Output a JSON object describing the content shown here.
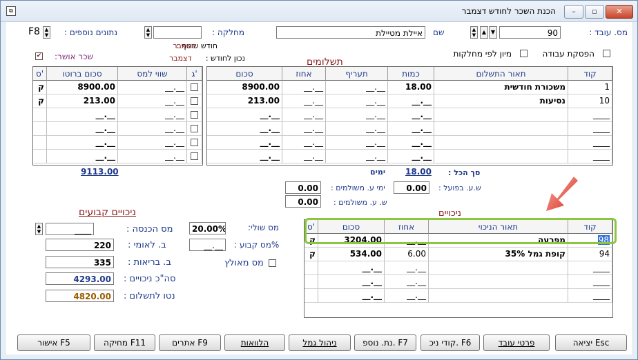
{
  "window": {
    "title": "הכנת השכר לחודש דצמבר",
    "min": "–",
    "max": "▫",
    "close": "✕"
  },
  "header": {
    "employee_no_label": "מס. עובד :",
    "employee_no": "90",
    "name_label": "שם",
    "name": "איילת מטיילת",
    "department_label": "מחלקה :",
    "department": "",
    "extra_data_label": "נתונים נוספים :",
    "extra_data_key": "F8"
  },
  "flags": {
    "stop_work": "הפסקת עבודה",
    "sort_by_dept": "מיון לפי מחלקות",
    "current_month_label": "חודש שוטף :",
    "current_month": "דצמבר",
    "correct_to_month_label": "נכון לחודש :",
    "correct_to_month": "דצמבר",
    "approved_salary": "שכר אושר:",
    "approved_mark": "✔"
  },
  "payments": {
    "title": "תשלומים",
    "columns": {
      "code": "קוד",
      "desc": "תאור התשלום",
      "qty": "כמות",
      "rate": "תעריף",
      "pct": "אחוז",
      "amount": "סכום"
    },
    "rows": [
      {
        "code": "1",
        "desc": "משכורת חודשית",
        "qty": "18.00",
        "rate": "__.__",
        "pct": "__.__",
        "amount": "8900.00"
      },
      {
        "code": "10",
        "desc": "נסיעות",
        "qty": "__.__",
        "rate": "__.__",
        "pct": "__.__",
        "amount": "213.00"
      },
      {
        "code": "____",
        "desc": "",
        "qty": "__.__",
        "rate": "__.__",
        "pct": "__.__",
        "amount": "__.__"
      },
      {
        "code": "____",
        "desc": "",
        "qty": "__.__",
        "rate": "__.__",
        "pct": "__.__",
        "amount": "__.__"
      },
      {
        "code": "____",
        "desc": "",
        "qty": "__.__",
        "rate": "__.__",
        "pct": "__.__",
        "amount": "__.__"
      },
      {
        "code": "____",
        "desc": "",
        "qty": "__.__",
        "rate": "__.__",
        "pct": "__.__",
        "amount": "__.__"
      }
    ]
  },
  "gross": {
    "columns": {
      "g": "ג'",
      "taxable": "שווי למס",
      "gross": "סכום ברוטו",
      "s": "ס'"
    },
    "rows": [
      {
        "taxable": "__.__",
        "gross": "8900.00",
        "s": "ק"
      },
      {
        "taxable": "__.__",
        "gross": "213.00",
        "s": "ק"
      },
      {
        "taxable": "__.__",
        "gross": "__.__",
        "s": ""
      },
      {
        "taxable": "__.__",
        "gross": "__.__",
        "s": ""
      },
      {
        "taxable": "__.__",
        "gross": "__.__",
        "s": ""
      },
      {
        "taxable": "__.__",
        "gross": "__.__",
        "s": ""
      }
    ]
  },
  "totals": {
    "total_label": "סך הכל :",
    "total_days": "18.00",
    "days_label": "ימים",
    "total_gross": "9113.00",
    "actual_hours_label": "ש.ע. בפועל :",
    "actual_hours": "0.00",
    "paid_days_label": "ימי ע. משולמים :",
    "paid_days": "0.00",
    "paid_hours_label": "ש. ע. משולמים :",
    "paid_hours": "0.00"
  },
  "fixed_deductions": {
    "title": "ניכויים קבועים",
    "income_tax_label": "מס הכנסה :",
    "income_tax": "____",
    "national_ins_label": "ב. לאומי :",
    "national_ins": "220",
    "health_label": "ב. בריאות :",
    "health": "335",
    "total_ded_label": "סה\"כ ניכויים :",
    "total_ded": "4293.00",
    "net_label": "נטו לתשלום :",
    "net": "4820.00",
    "marginal_tax_label": "מס שולי:",
    "marginal_tax": "20.00%",
    "fixed_tax_label": "%מס קבוע :",
    "fixed_tax": "__.__",
    "advance_tax_label": "מס מאולץ"
  },
  "deductions": {
    "title": "ניכויים",
    "columns": {
      "code": "קוד",
      "desc": "תאור הניכוי",
      "pct": "אחוז",
      "amount": "סכום",
      "s": "ס'"
    },
    "rows": [
      {
        "code": "98",
        "desc": "מפרעה",
        "pct": "__.__",
        "amount": "3204.00",
        "s": "ק"
      },
      {
        "code": "94",
        "desc": "קופת גמל 35%",
        "pct": "6.00",
        "amount": "534.00",
        "s": "ק"
      },
      {
        "code": "____",
        "desc": "",
        "pct": "__.__",
        "amount": "__.__",
        "s": ""
      },
      {
        "code": "____",
        "desc": "",
        "pct": "__.__",
        "amount": "__.__",
        "s": ""
      },
      {
        "code": "____",
        "desc": "",
        "pct": "__.__",
        "amount": "__.__",
        "s": ""
      }
    ]
  },
  "buttons": {
    "exit": "יציאה Esc",
    "employee_details": "פרטי עובד",
    "ded_codes": "קודי ניכ. F6",
    "add_data": "נת. נוספ. F7",
    "provident": "ניהול גמל",
    "loans": "הלוואות",
    "credits": "אתרים F9",
    "delete": "מחיקה F11",
    "approve": "אישור F5"
  },
  "colors": {
    "highlight": "#8cc63f",
    "arrow": "#e03a2a",
    "navy": "#1f3a8a",
    "maroon": "#8b1a1a",
    "net": "#9a5a00"
  }
}
